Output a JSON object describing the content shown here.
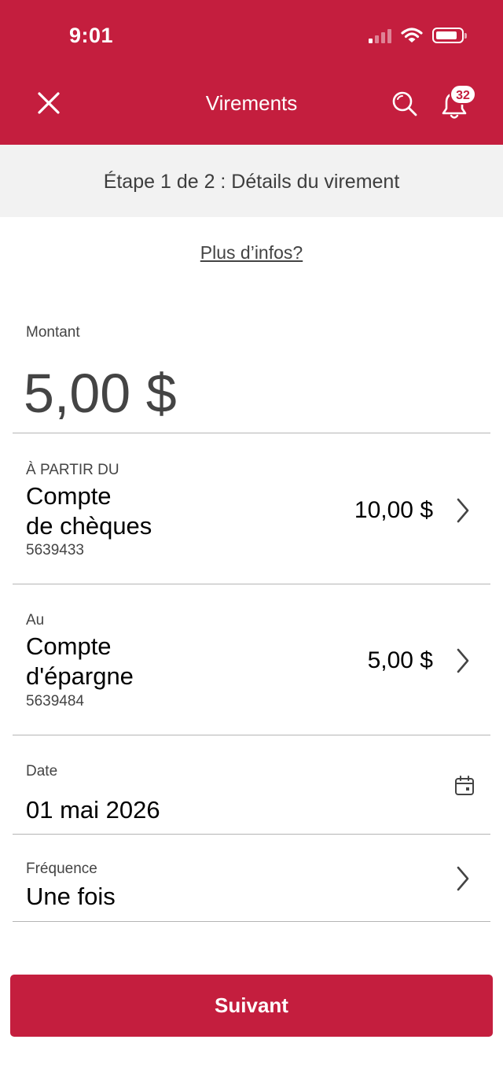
{
  "status_bar": {
    "time": "9:01"
  },
  "header": {
    "title": "Virements",
    "notifications_count": "32",
    "accent_color": "#c41e3e",
    "icons": [
      "close-icon",
      "search-icon",
      "bell-icon"
    ]
  },
  "step": {
    "text": "Étape 1 de 2 : Détails du virement"
  },
  "more_info": {
    "label": "Plus d’infos?"
  },
  "amount": {
    "label": "Montant",
    "value": "5,00 $"
  },
  "from_account": {
    "label": "À PARTIR DU",
    "name_line1": "Compte",
    "name_line2": "de chèques",
    "number": "5639433",
    "balance": "10,00 $"
  },
  "to_account": {
    "label": "Au",
    "name_line1": "Compte",
    "name_line2": "d'épargne",
    "number": "5639484",
    "balance": "5,00 $"
  },
  "date": {
    "label": "Date",
    "value": "01 mai 2026"
  },
  "frequency": {
    "label": "Fréquence",
    "value": "Une fois"
  },
  "next_button": {
    "label": "Suivant"
  }
}
